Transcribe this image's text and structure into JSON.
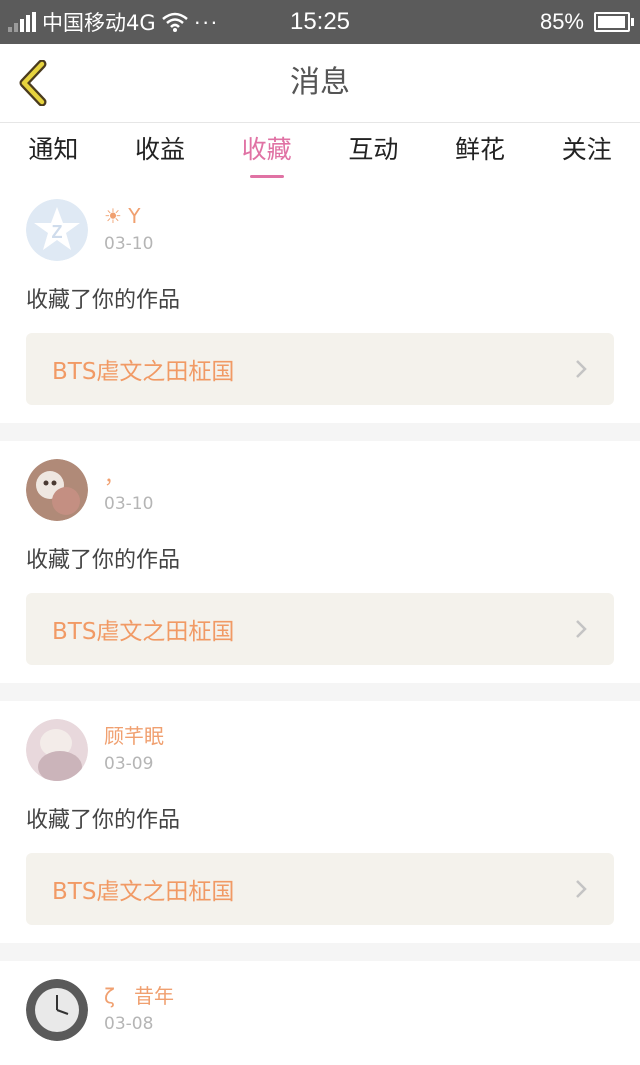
{
  "status_bar": {
    "carrier": "中国移动4G",
    "dots": "···",
    "time": "15:25",
    "battery": "85%"
  },
  "header": {
    "title": "消息"
  },
  "tabs": [
    {
      "label": "通知"
    },
    {
      "label": "收益"
    },
    {
      "label": "收藏",
      "active": true
    },
    {
      "label": "互动"
    },
    {
      "label": "鲜花"
    },
    {
      "label": "关注"
    }
  ],
  "messages": [
    {
      "user": "☀ Y",
      "date": "03-10",
      "action": "收藏了你的作品",
      "work": "BTS虐文之田柾国"
    },
    {
      "user": "，",
      "date": "03-10",
      "action": "收藏了你的作品",
      "work": "BTS虐文之田柾国"
    },
    {
      "user": "顾芊眠",
      "date": "03-09",
      "action": "收藏了你的作品",
      "work": "BTS虐文之田柾国"
    },
    {
      "user": "ζ   昔年",
      "date": "03-08"
    }
  ],
  "colors": {
    "accent": "#e072a4",
    "name": "#f0a070",
    "work": "#f19a65",
    "link_bg": "#f4f2ec"
  }
}
